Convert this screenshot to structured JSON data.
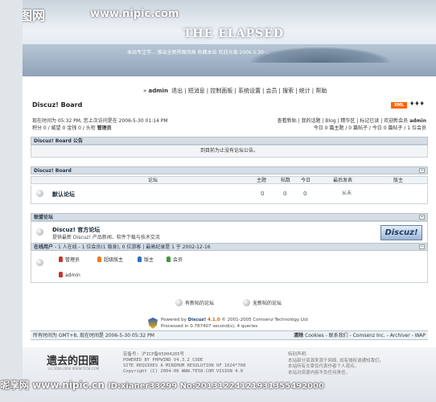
{
  "banner": {
    "title": "THE ELAPSED",
    "subtitle": "(c) 2004-2006 WWW.TE58.COM",
    "scroll_text": "本站专注学... 推出全新界面风格 收藏本站 欢迎光临·2006.5.30·...",
    "watermark_site": "昵图网",
    "watermark_url": "www.nipic.com"
  },
  "nav": {
    "user": "admin",
    "items": [
      "退出",
      "短消息",
      "控制面板",
      "系统设置",
      "会员",
      "搜索",
      "统计",
      "帮助"
    ]
  },
  "forum": {
    "title": "Discuz! Board",
    "xml_label": "XML",
    "info_left_line1": "现在时间为 05:32 PM, 您上次访问是在 2006-5-30 01:14 PM",
    "info_left_line2_prefix": "积分 0 / 威望 0 金钱 0 / 头衔 ",
    "info_left_title": "管理员",
    "info_right_line1_links": [
      "查看新贴",
      "我的话题",
      "Blog",
      "精华区",
      "标记已读",
      "欢迎新会员"
    ],
    "info_right_line1_user": "admin",
    "info_right_line2": "今日 0 篇主题 / 0 篇帖子 / 今日 0 篇帖子 / 1 位会员"
  },
  "announcement": {
    "header": "Discuz! Board 公告",
    "text": "到目前为止没有论坛公告。"
  },
  "board": {
    "header": "Discuz! Board",
    "columns": [
      "论坛",
      "主题",
      "帖数",
      "今日",
      "最后发表",
      "版主"
    ],
    "rows": [
      {
        "name": "默认论坛",
        "topics": "0",
        "posts": "0",
        "today": "0",
        "latest": "从未",
        "moderator": ""
      }
    ]
  },
  "partners": {
    "header": "联盟论坛",
    "name": "Discuz! 官方论坛",
    "desc": "提供最新 Discuz! 产品新闻、软件下载与技术交流",
    "logo_text": "Discuz!"
  },
  "online": {
    "label": "在线用户",
    "summary": " - 1 人在线 - 1 位会员(1 隐身), 0 位游客 | 最高纪录是 1 于 2002-12-16",
    "legend": [
      {
        "label": "管理员",
        "color": "#c0392b"
      },
      {
        "label": "超级版主",
        "color": "#e67e22"
      },
      {
        "label": "版主",
        "color": "#2e6fbf"
      },
      {
        "label": "会员",
        "color": "#3a9a3a"
      }
    ],
    "current_user": "admin"
  },
  "status": {
    "new_label": "有新帖的论坛",
    "no_new_label": "无新帖的论坛"
  },
  "powered": {
    "line1_prefix": "Powered by ",
    "product": "Discuz!",
    "version": "4.1.0",
    "line1_suffix": " © 2001-2005 Comsenz Technology Ltd",
    "line2": "Processed in 0.787407 second(s), 4 queries"
  },
  "footer": {
    "left": "所有时间为 GMT+8, 现在时间是 2006-5-30 05:32 PM",
    "right_prefix": "清除 ",
    "right_links": "Cookies - 联系我们 - Comsenz Inc. - Archiver - WAP"
  },
  "bottom_banner": {
    "brand": "遗去的田園",
    "brand_sub": "(c) 2004-2006 WWW.TE58.COM",
    "mid_line1": "宏备号: 沪ICP备05004205号",
    "mid_line2": "POWERED BY PHPWIND V4.3.2 CODE",
    "mid_line3": "SITE REQUIRES A MINIMUM RESOLUTION OF 1024*768",
    "mid_line4": "Copyright (C) 2004-06 WWW.TE58.COM VISION 4.0",
    "right_line1": "特别声明:",
    "right_line2": "本站部分资源来源于网络, 如有侵权请通知我们。",
    "right_line3": "本站所有文章仅代表作者个人观点。",
    "right_line4": "本站对资源内容不负任何责任。"
  },
  "watermark_bottom": {
    "text": "昵享网 www.nipic.cn",
    "id": "ID:xianer33299 No:20131224121931355492000"
  }
}
